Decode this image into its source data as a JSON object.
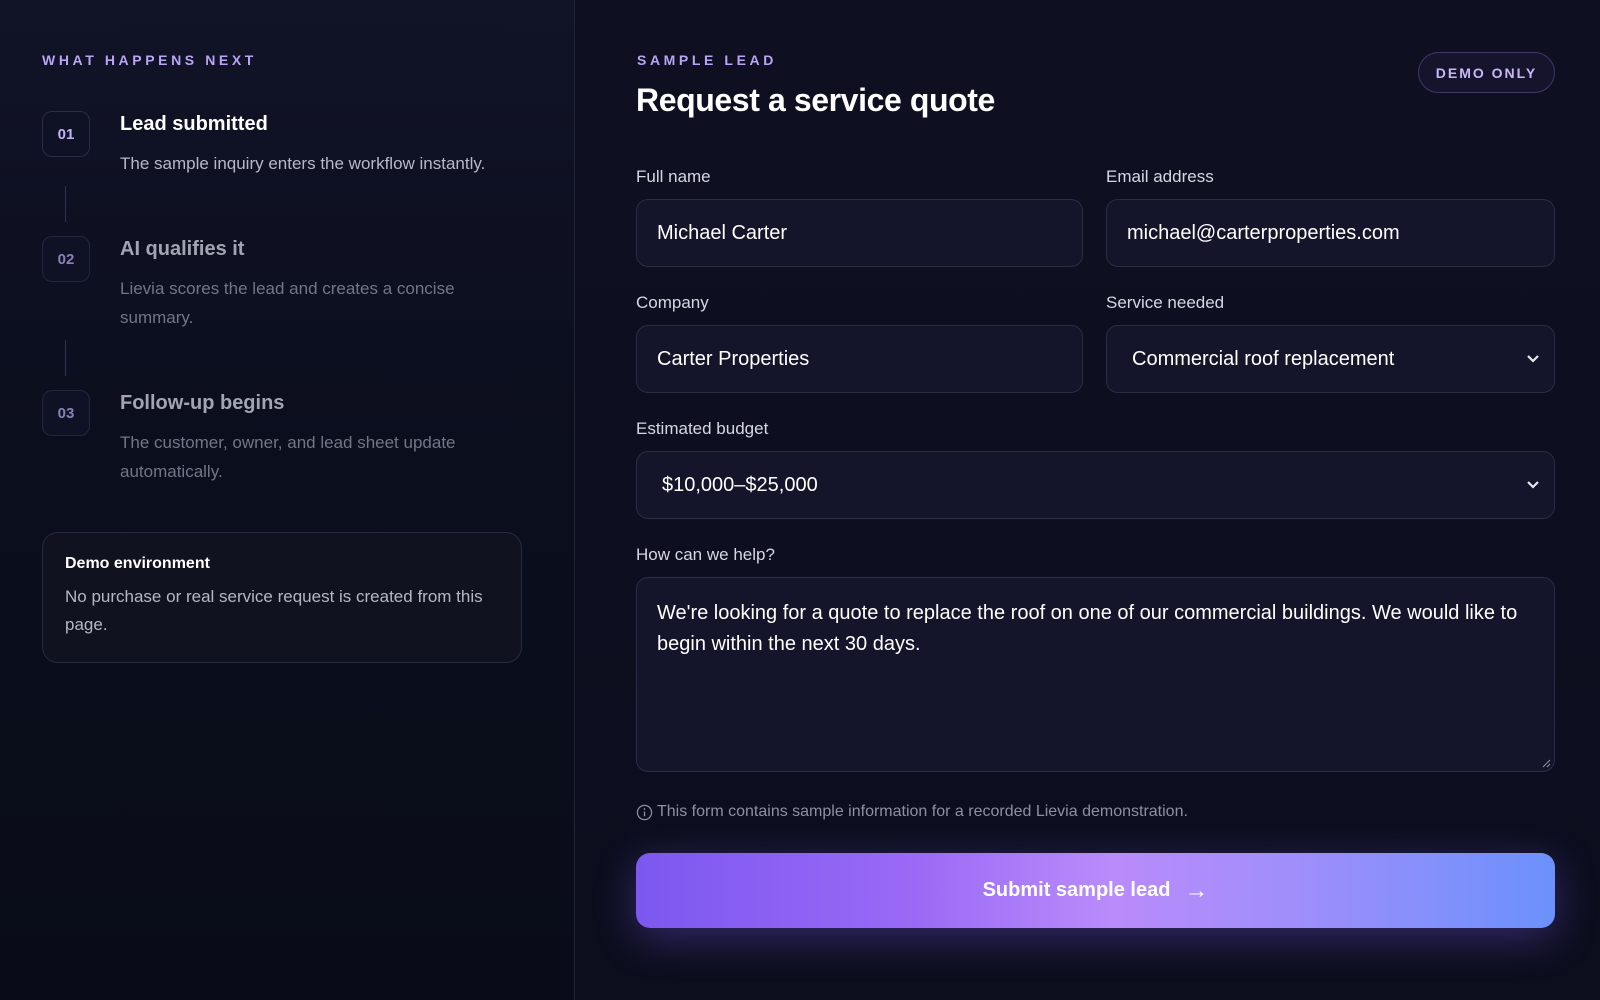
{
  "left_panel": {
    "eyebrow": "WHAT HAPPENS NEXT",
    "steps": [
      {
        "number": "01",
        "title": "Lead submitted",
        "description": "The sample inquiry enters the workflow instantly."
      },
      {
        "number": "02",
        "title": "AI qualifies it",
        "description": "Lievia scores the lead and creates a concise summary."
      },
      {
        "number": "03",
        "title": "Follow-up begins",
        "description": "The customer, owner, and lead sheet update automatically."
      }
    ],
    "demo_box": {
      "title": "Demo environment",
      "text": "No purchase or real service request is created from this page."
    }
  },
  "form": {
    "eyebrow": "SAMPLE LEAD",
    "title": "Request a service quote",
    "badge": "DEMO ONLY",
    "full_name": {
      "label": "Full name",
      "value": "Michael Carter"
    },
    "email": {
      "label": "Email address",
      "value": "michael@carterproperties.com"
    },
    "company": {
      "label": "Company",
      "value": "Carter Properties"
    },
    "service": {
      "label": "Service needed",
      "value": "Commercial roof replacement"
    },
    "budget": {
      "label": "Estimated budget",
      "value": "$10,000–$25,000"
    },
    "message": {
      "label": "How can we help?",
      "value": "We're looking for a quote to replace the roof on one of our commercial buildings. We would like to begin within the next 30 days."
    },
    "note": "This form contains sample information for a recorded Lievia demonstration.",
    "submit_label": "Submit sample lead",
    "submit_arrow": "→"
  },
  "icons": {
    "info": "info-icon",
    "chevron": "chevron-down-icon",
    "arrow": "arrow-right-icon"
  },
  "colors": {
    "accent": "#b9a4f5",
    "gradient_start": "#7c58f0",
    "gradient_end": "#6b91fb",
    "background": "#0b0d1a"
  }
}
